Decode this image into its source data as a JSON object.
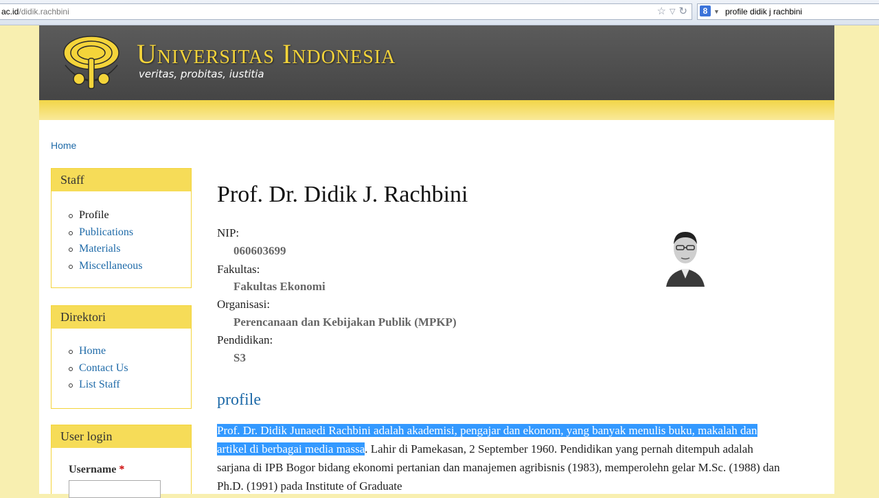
{
  "browser": {
    "url_prefix": "ac.id",
    "url_path": "/didik.rachbini",
    "search_engine_icon": "8",
    "search_query": "profile didik j rachbini",
    "icons": [
      "star-icon",
      "dropdown-triangle-icon",
      "reload-icon"
    ]
  },
  "site": {
    "name": "Universitas Indonesia",
    "slogan": "veritas, probitas, iustitia",
    "colors": {
      "banner": "#4f4f4f",
      "accent": "#f4d43a",
      "link": "#1e6aa8"
    }
  },
  "breadcrumb": "Home",
  "sidebar": {
    "staff": {
      "title": "Staff",
      "items": [
        "Profile",
        "Publications",
        "Materials",
        "Miscellaneous"
      ]
    },
    "direktori": {
      "title": "Direktori",
      "items": [
        "Home",
        "Contact Us",
        "List Staff"
      ]
    },
    "login": {
      "title": "User login",
      "username_label": "Username",
      "required_mark": "*"
    }
  },
  "profile": {
    "name": "Prof. Dr. Didik J. Rachbini",
    "fields": [
      {
        "label": "NIP:",
        "value": "060603699"
      },
      {
        "label": "Fakultas:",
        "value": "Fakultas Ekonomi"
      },
      {
        "label": "Organisasi:",
        "value": "Perencanaan dan Kebijakan Publik (MPKP)"
      },
      {
        "label": "Pendidikan:",
        "value": "S3"
      }
    ],
    "section_heading": "profile",
    "bio_highlighted": "Prof. Dr. Didik Junaedi Rachbini adalah akademisi, pengajar dan ekonom, yang banyak menulis buku, makalah dan artikel di berbagai media massa",
    "bio_rest": ".  Lahir di Pamekasan, 2 September 1960.  Pendidikan yang pernah ditempuh adalah sarjana di IPB Bogor bidang ekonomi pertanian dan manajemen agribisnis (1983), memperolehn gelar M.Sc. (1988) dan Ph.D. (1991) pada Institute of Graduate"
  }
}
